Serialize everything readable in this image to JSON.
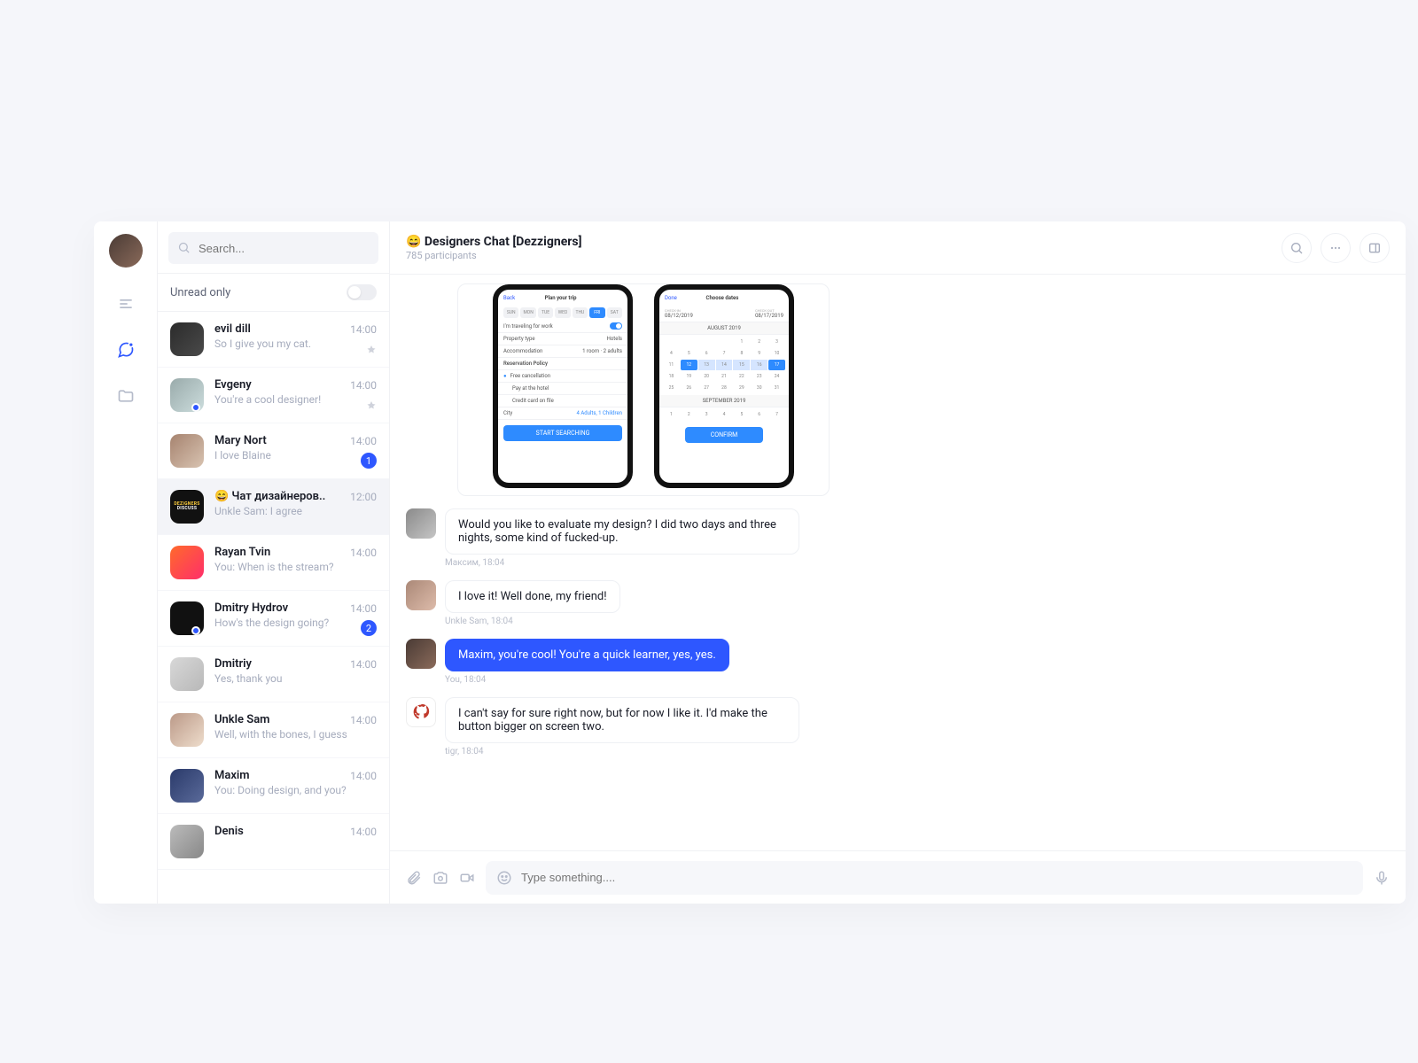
{
  "rail": {
    "menu_name": "menu",
    "chat_name": "chats",
    "folder_name": "folders"
  },
  "sidebar": {
    "search_placeholder": "Search...",
    "unread_label": "Unread only",
    "chats": [
      {
        "name": "evil dill",
        "preview": "So I give you my cat.",
        "time": "14:00",
        "pinned": true,
        "badge": null,
        "online": false,
        "av": "av-c1"
      },
      {
        "name": "Evgeny",
        "preview": "You're a cool designer!",
        "time": "14:00",
        "pinned": true,
        "badge": null,
        "online": true,
        "av": "av-c2"
      },
      {
        "name": "Mary Nort",
        "preview": "I love Blaine",
        "time": "14:00",
        "pinned": false,
        "badge": "1",
        "online": false,
        "av": "av-c3"
      },
      {
        "name": "😄 Чат дизайнеров..",
        "preview": "Unkle Sam: I agree",
        "time": "12:00",
        "pinned": false,
        "badge": null,
        "online": false,
        "av": "av-c4",
        "active": true
      },
      {
        "name": "Rayan Tvin",
        "preview": "You: When is the stream?",
        "time": "14:00",
        "pinned": false,
        "badge": null,
        "online": false,
        "av": "av-c5"
      },
      {
        "name": "Dmitry Hydrov",
        "preview": "How's the design going?",
        "time": "14:00",
        "pinned": false,
        "badge": "2",
        "online": true,
        "av": "av-c6"
      },
      {
        "name": "Dmitriy",
        "preview": "Yes, thank you",
        "time": "14:00",
        "pinned": false,
        "badge": null,
        "online": false,
        "av": "av-c7"
      },
      {
        "name": "Unkle Sam",
        "preview": "Well, with the bones, I guess",
        "time": "14:00",
        "pinned": false,
        "badge": null,
        "online": false,
        "av": "av-c8"
      },
      {
        "name": "Maxim",
        "preview": "You: Doing design, and you?",
        "time": "14:00",
        "pinned": false,
        "badge": null,
        "online": false,
        "av": "av-c9"
      },
      {
        "name": "Denis",
        "preview": "",
        "time": "14:00",
        "pinned": false,
        "badge": null,
        "online": false,
        "av": "av-c10"
      }
    ]
  },
  "header": {
    "title": "😄 Designers Chat [Dezzigners]",
    "subtitle": "785 participants"
  },
  "phones": {
    "p1": {
      "back": "Back",
      "title": "Plan your trip",
      "r1": "I'm traveling for work",
      "r2": "Property type",
      "r2v": "Hotels",
      "r3": "Accommodation",
      "r3v": "1 room · 2 adults",
      "r4": "Reservation Policy",
      "r5": "Free cancellation",
      "r6": "Pay at the hotel",
      "r7": "Credit card on file",
      "city": "City",
      "cityv": "4 Adults, 1 Children",
      "btn": "START SEARCHING"
    },
    "p2": {
      "done": "Done",
      "title": "Choose dates",
      "in": "CHECK-IN",
      "out": "CHECK-OUT",
      "ind": "08/12/2019",
      "outd": "08/17/2019",
      "month": "AUGUST 2019",
      "month2": "SEPTEMBER 2019",
      "btn": "CONFIRM"
    }
  },
  "messages": [
    {
      "author": "Максим",
      "time": "18:04",
      "text": "Would you like to evaluate my design? I did two days and three nights, some kind of fucked-up.",
      "me": false,
      "av": "av-m1"
    },
    {
      "author": "Unkle Sam",
      "time": "18:04",
      "text": "I love it! Well done, my friend!",
      "me": false,
      "av": "av-m2"
    },
    {
      "author": "You",
      "time": "18:04",
      "text": "Maxim, you're cool! You're a quick learner, yes, yes.",
      "me": true,
      "av": "av-m3"
    },
    {
      "author": "tigr",
      "time": "18:04",
      "text": "I can't say for sure right now, but for now I like it. I'd make the button bigger on screen two.",
      "me": false,
      "av": "av-m4"
    }
  ],
  "composer": {
    "placeholder": "Type something...."
  }
}
